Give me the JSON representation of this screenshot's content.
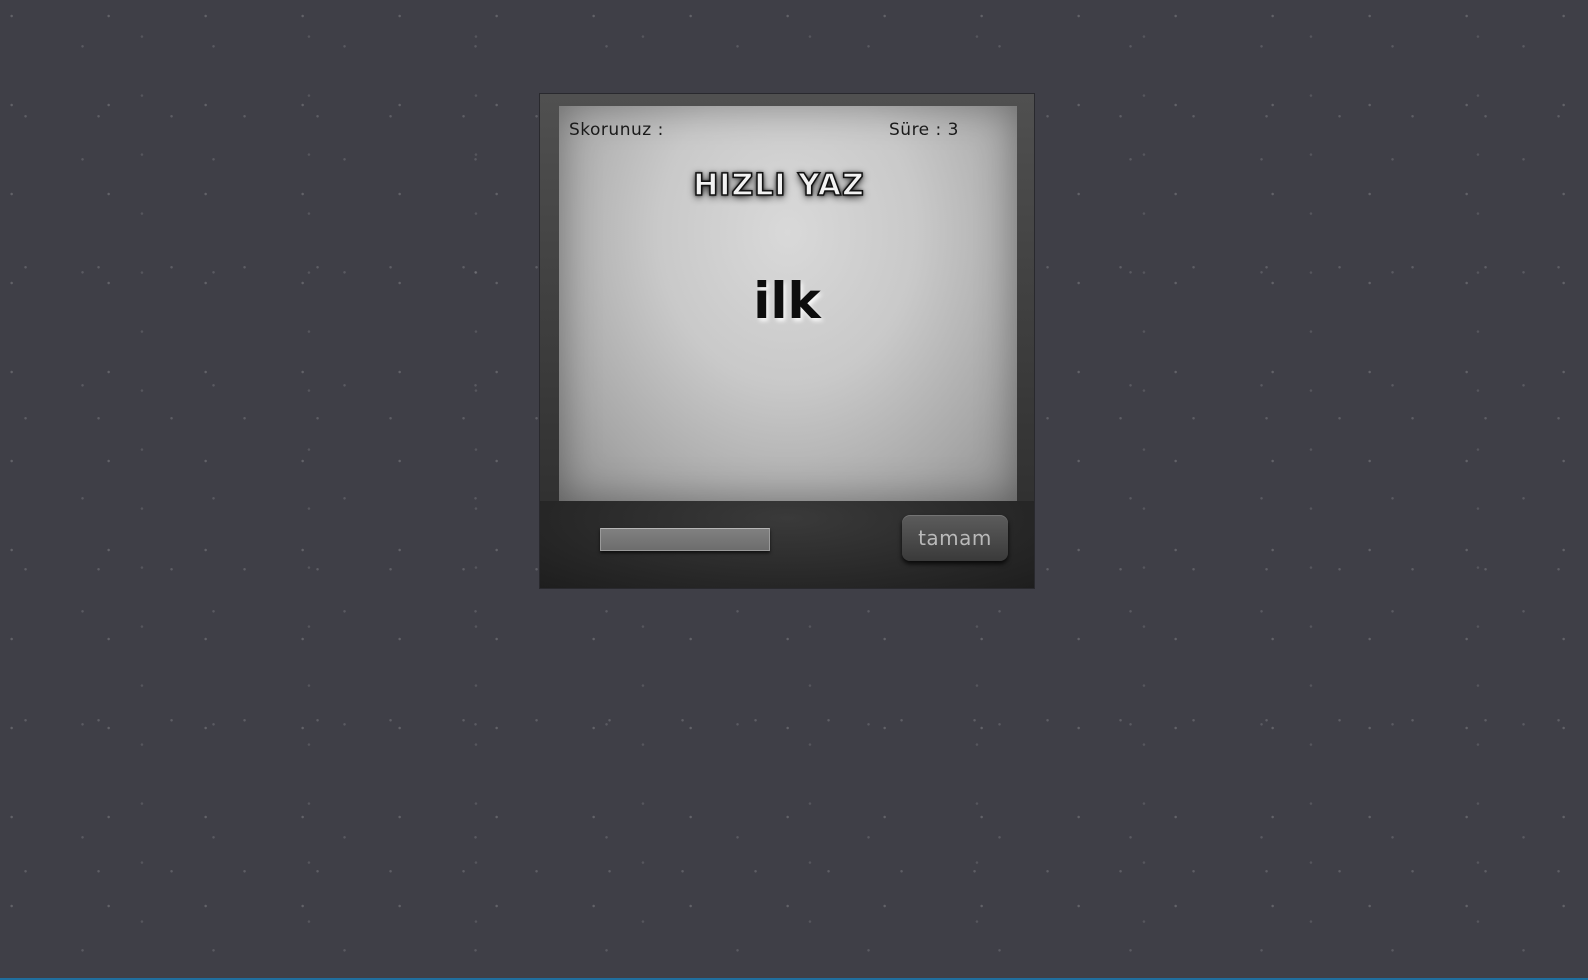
{
  "game": {
    "title": "HIZLI YAZ",
    "score_label": "Skorunuz :",
    "timer_text": "Süre : 3",
    "current_word": "ilk",
    "input_value": "",
    "submit_label": "tamam"
  },
  "colors": {
    "page_background": "#3f3f47",
    "accent_line": "#1f6f9f"
  }
}
